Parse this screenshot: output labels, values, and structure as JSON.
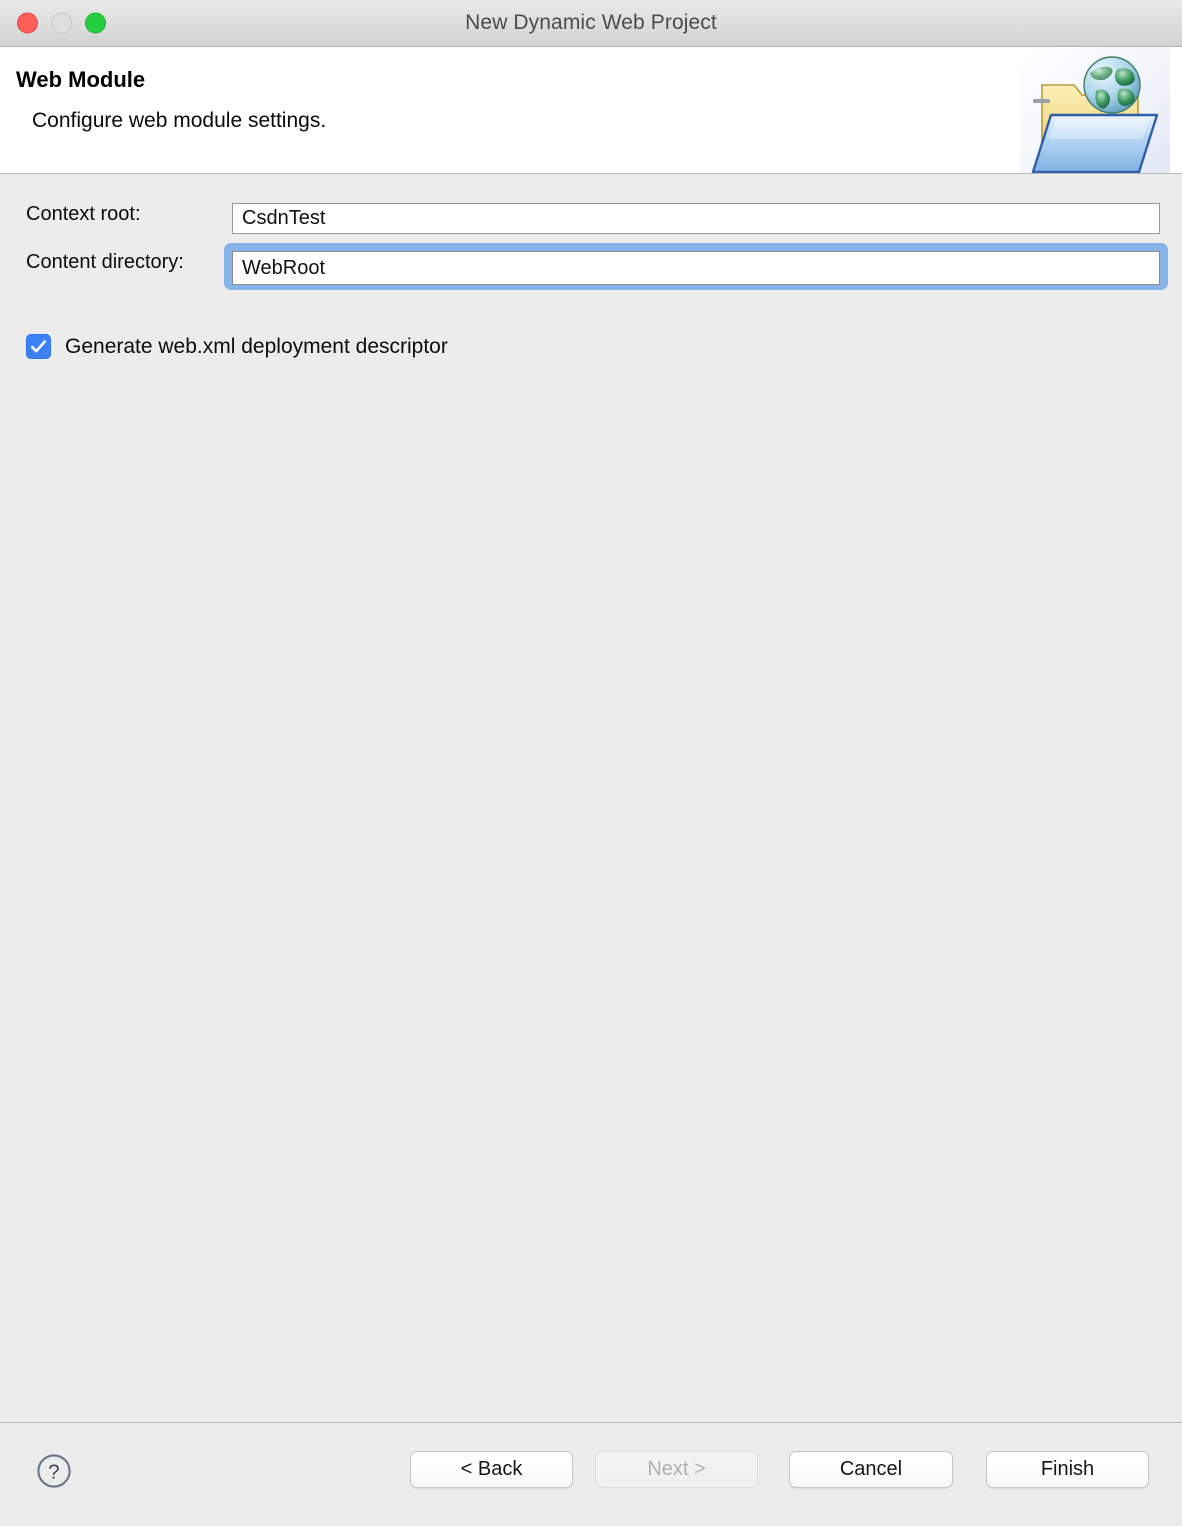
{
  "window": {
    "title": "New Dynamic Web Project",
    "traffic_lights": {
      "close": "close-button",
      "minimize": "minimize-button",
      "maximize": "maximize-button"
    }
  },
  "header": {
    "title": "Web Module",
    "subtitle": "Configure web module settings.",
    "icon": "web-folder-globe-icon"
  },
  "form": {
    "fields": [
      {
        "label": "Context root:",
        "value": "CsdnTest",
        "placeholder": "",
        "focused": false
      },
      {
        "label": "Content directory:",
        "value": "WebRoot",
        "placeholder": "",
        "focused": true
      }
    ],
    "checkbox": {
      "label": "Generate web.xml deployment descriptor",
      "checked": true
    }
  },
  "footer": {
    "help_icon": "help-question-icon",
    "buttons": [
      {
        "label": "< Back",
        "enabled": true
      },
      {
        "label": "Next >",
        "enabled": false
      },
      {
        "label": "Cancel",
        "enabled": true
      },
      {
        "label": "Finish",
        "enabled": true
      }
    ]
  },
  "colors": {
    "accent": "#3c82f6",
    "focus_ring": "#86b3e8",
    "window_bg": "#ececec",
    "header_bg": "#ffffff",
    "close": "#fc6058",
    "minimize": "#dedede",
    "maximize": "#28cc41"
  }
}
